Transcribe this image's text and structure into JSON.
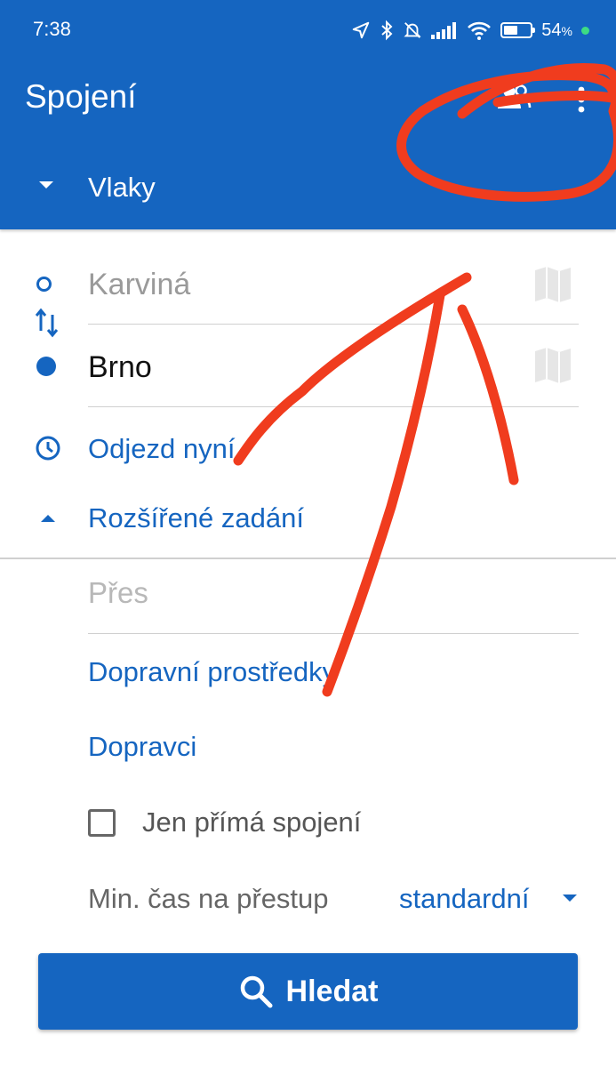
{
  "status_bar": {
    "time": "7:38",
    "battery_percent": "54",
    "battery_unit": "%"
  },
  "app_bar": {
    "title": "Spojení",
    "mode": "Vlaky"
  },
  "form": {
    "from": {
      "value": "Karviná"
    },
    "to": {
      "value": "Brno"
    },
    "departure": "Odjezd nyní",
    "advanced": "Rozšířené zadání",
    "via_placeholder": "Přes",
    "transport_means": "Dopravní prostředky",
    "carriers": "Dopravci",
    "direct_only": {
      "label": "Jen přímá spojení",
      "checked": false
    },
    "min_transfer": {
      "label": "Min. čas na přestup",
      "value": "standardní"
    }
  },
  "search_button": {
    "label": "Hledat"
  },
  "colors": {
    "primary": "#1565c0",
    "annotation": "#f03c1e"
  },
  "icons": [
    "navigation-icon",
    "bluetooth-icon",
    "bell-off-icon",
    "signal-icon",
    "wifi-icon",
    "battery-icon",
    "people-icon",
    "more-vert-icon",
    "map-icon",
    "swap-icon",
    "clock-icon",
    "search-icon"
  ]
}
